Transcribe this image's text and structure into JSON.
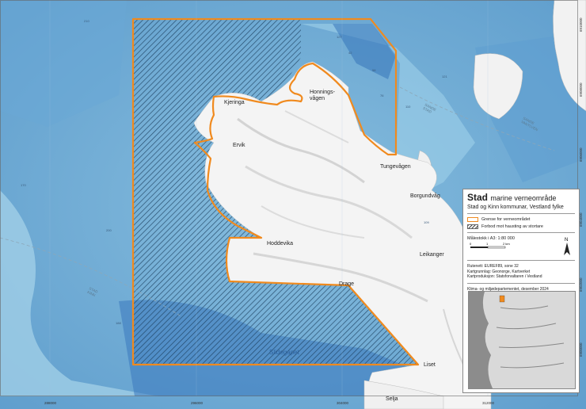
{
  "map": {
    "place_labels": [
      {
        "id": "kjeringa",
        "text": "Kjeringa"
      },
      {
        "id": "honningsvagen",
        "text": "Honnings-\nvågen"
      },
      {
        "id": "ervik",
        "text": "Ervik"
      },
      {
        "id": "tungevagen",
        "text": "Tungevågen"
      },
      {
        "id": "borgundvag",
        "text": "Borgundvåg"
      },
      {
        "id": "hoddevika",
        "text": "Hoddevika"
      },
      {
        "id": "leikanger",
        "text": "Leikanger"
      },
      {
        "id": "drage",
        "text": "Drage"
      },
      {
        "id": "liset",
        "text": "Liset"
      },
      {
        "id": "selja",
        "text": "Selja"
      }
    ],
    "sea_label": "Slidegapet",
    "border_labels": {
      "stad_kinn": "STAD\nKINN",
      "sande_stad": "SANDE\nSTAD",
      "sande_vanylven": "SANDE\nVANYLVEN"
    },
    "x_ticks": [
      "288000",
      "296000",
      "304000",
      "312000"
    ],
    "y_ticks": [
      "6910000",
      "6908000",
      "6906000",
      "6904000",
      "6902000",
      "6900000"
    ],
    "colors": {
      "protected_border": "#f08a1e",
      "land": "#f4f4f4",
      "deep_sea": "#2f6fb8",
      "shallow_sea": "#8ec6e4"
    }
  },
  "legend": {
    "title": "Stad",
    "title_suffix": "marine verneområde",
    "subtitle": "Stad og Kinn kommunar, Vestland fylke",
    "items": [
      {
        "symbol": "orange-outline",
        "label": "Grense for verneområdet"
      },
      {
        "symbol": "hatch",
        "label": "Forbod mot hausting av stortare"
      }
    ],
    "scale_text": "Målestokk i A3: 1:80 000",
    "scale_ticks": [
      "0",
      "1",
      "2 km"
    ],
    "north_label": "N",
    "credits": [
      "Rutenett: EUREF89, sone 32",
      "Kartgrunnlag: Geonorge, Kartverket",
      "Kartproduksjon: Statsforvaltaren i Vestland"
    ],
    "footer": "Klima- og miljødepartementet, desember 2024"
  }
}
